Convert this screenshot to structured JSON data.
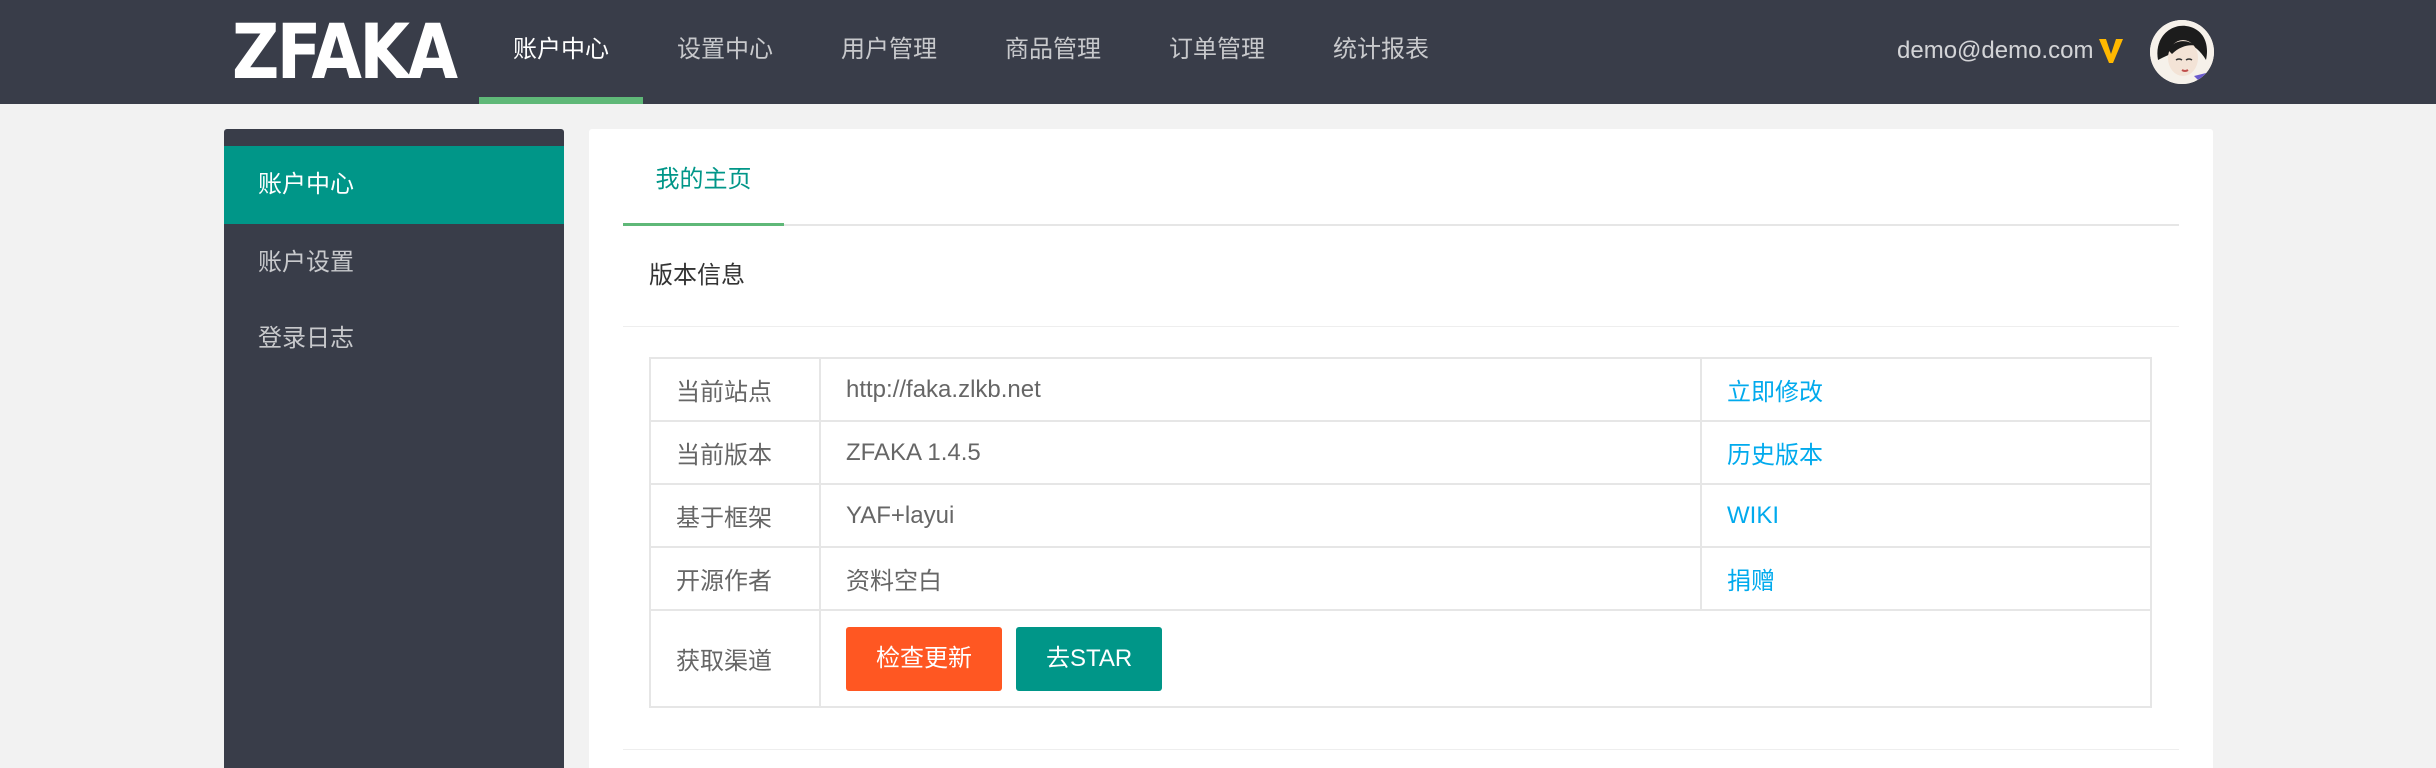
{
  "header": {
    "logo": "ZFAKA",
    "nav": [
      {
        "label": "账户中心",
        "active": true
      },
      {
        "label": "设置中心",
        "active": false
      },
      {
        "label": "用户管理",
        "active": false
      },
      {
        "label": "商品管理",
        "active": false
      },
      {
        "label": "订单管理",
        "active": false
      },
      {
        "label": "统计报表",
        "active": false
      }
    ],
    "user_email": "demo@demo.com",
    "vip_icon": "vip-v-icon",
    "avatar_icon": "user-avatar"
  },
  "sidebar": {
    "items": [
      {
        "label": "账户中心",
        "active": true
      },
      {
        "label": "账户设置",
        "active": false
      },
      {
        "label": "登录日志",
        "active": false
      }
    ]
  },
  "main": {
    "tab": "我的主页",
    "card_title": "版本信息",
    "rows": [
      {
        "label": "当前站点",
        "value": "http://faka.zlkb.net",
        "action": "立即修改"
      },
      {
        "label": "当前版本",
        "value": "ZFAKA 1.4.5",
        "action": "历史版本"
      },
      {
        "label": "基于框架",
        "value": "YAF+layui",
        "action": "WIKI"
      },
      {
        "label": "开源作者",
        "value": "资料空白",
        "action": "捐赠"
      }
    ],
    "channel": {
      "label": "获取渠道",
      "check_update": "检查更新",
      "star": "去STAR"
    }
  },
  "colors": {
    "header_bg": "#393d49",
    "accent_green": "#009688",
    "tab_underline": "#5fb878",
    "link_blue": "#01aaed",
    "button_orange": "#ff5722",
    "vip_gold": "#ffb800"
  }
}
